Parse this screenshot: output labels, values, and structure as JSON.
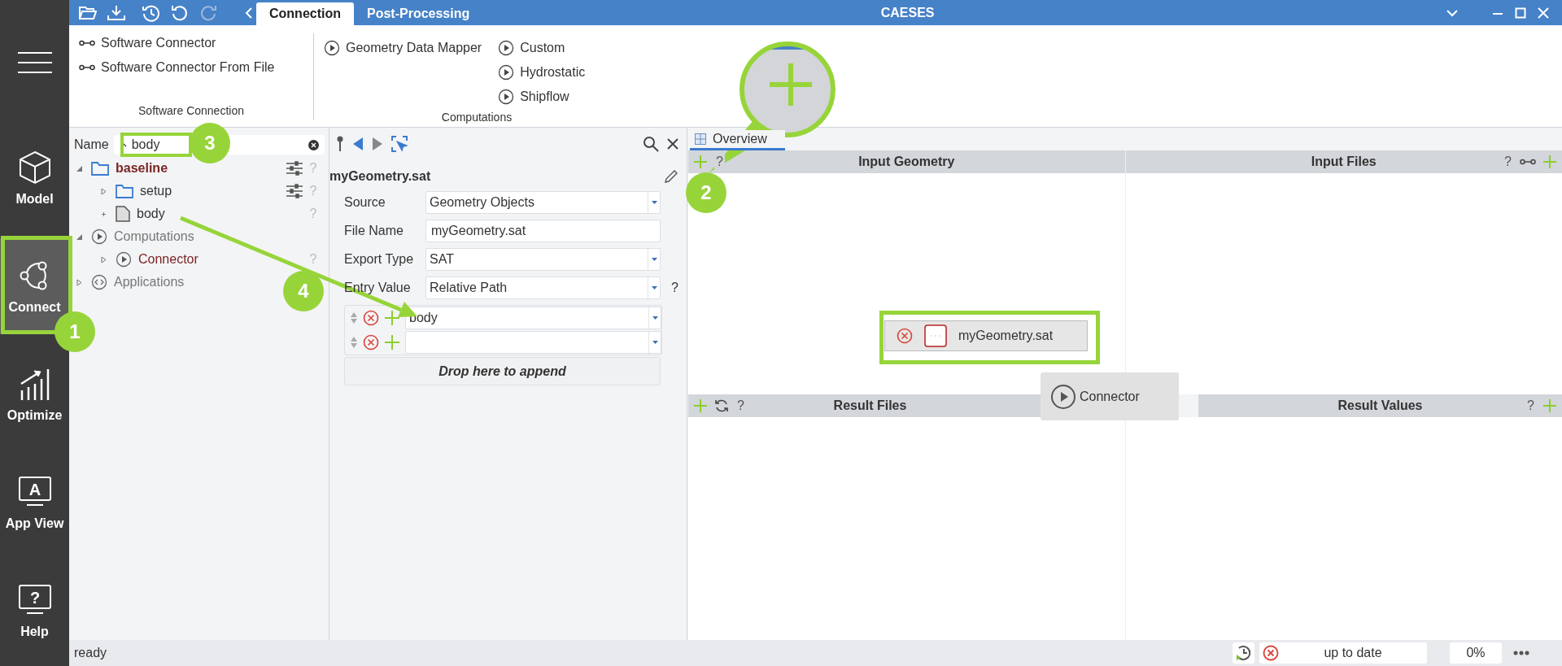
{
  "window": {
    "title": "CAESES"
  },
  "sidebar": {
    "items": [
      {
        "label": "Model",
        "selected": false
      },
      {
        "label": "Connect",
        "selected": true
      },
      {
        "label": "Optimize",
        "selected": false
      },
      {
        "label": "App View",
        "glyph": "A",
        "selected": false
      },
      {
        "label": "Help",
        "glyph": "?",
        "selected": false
      }
    ]
  },
  "tabs": [
    {
      "label": "Connection",
      "selected": true
    },
    {
      "label": "Post-Processing",
      "selected": false
    }
  ],
  "ribbon": {
    "groups": [
      {
        "label": "Software Connection",
        "kind": "connector",
        "columns": [
          [
            "Software Connector",
            "Software Connector From File"
          ]
        ]
      },
      {
        "label": "Computations",
        "kind": "computation",
        "columns": [
          [
            "Geometry Data Mapper"
          ],
          [
            "Custom",
            "Hydrostatic",
            "Shipflow"
          ]
        ]
      }
    ]
  },
  "tree": {
    "filter_label": "Name",
    "filter_value": "body",
    "items": [
      {
        "label": "baseline",
        "kind": "folder",
        "selected": true,
        "color": "#7a2323",
        "expanded": true,
        "has_settings": true,
        "help": "?",
        "children": [
          {
            "label": "setup",
            "kind": "folder",
            "selected": false,
            "color": "#333333",
            "expanded": false,
            "has_settings": true,
            "help": "?"
          },
          {
            "label": "body",
            "kind": "file",
            "selected": false,
            "color": "#333333",
            "help": "?"
          }
        ]
      },
      {
        "label": "Computations",
        "kind": "computation",
        "selected": false,
        "color": "#777777",
        "expanded": true,
        "children": [
          {
            "label": "Connector",
            "kind": "computation",
            "selected": false,
            "color": "#7a2323",
            "expanded": false,
            "help": "?"
          }
        ]
      },
      {
        "label": "Applications",
        "kind": "application",
        "selected": false,
        "color": "#777777",
        "expanded": false
      }
    ]
  },
  "editor": {
    "title": "myGeometry.sat",
    "fields": [
      {
        "label": "Source",
        "value": "Geometry Objects",
        "kind": "select"
      },
      {
        "label": "File Name",
        "value": "myGeometry.sat",
        "kind": "text"
      },
      {
        "label": "Export Type",
        "value": "SAT",
        "kind": "select"
      },
      {
        "label": "Entry Value",
        "value": "Relative Path",
        "kind": "select",
        "help": "?"
      }
    ],
    "entries": [
      {
        "kind": "value",
        "value": "body"
      },
      {
        "kind": "blank"
      }
    ],
    "drop_hint": "Drop here to append"
  },
  "overview": {
    "tab": "Overview",
    "sections": [
      {
        "title": "Input Geometry",
        "help": "?"
      },
      {
        "title": "Input Files",
        "help": "?"
      },
      {
        "title": "Result Files",
        "help": "?"
      },
      {
        "title": "Result Values",
        "help": "?"
      }
    ],
    "nodes": [
      {
        "label": "myGeometry.sat",
        "kind": "geometry"
      },
      {
        "label": "Connector",
        "kind": "computation"
      }
    ]
  },
  "status_bar": {
    "message": "ready",
    "state": "up to date",
    "progress": "0%"
  },
  "callouts": [
    {
      "number": "1"
    },
    {
      "number": "2"
    },
    {
      "number": "3"
    },
    {
      "number": "4"
    }
  ]
}
